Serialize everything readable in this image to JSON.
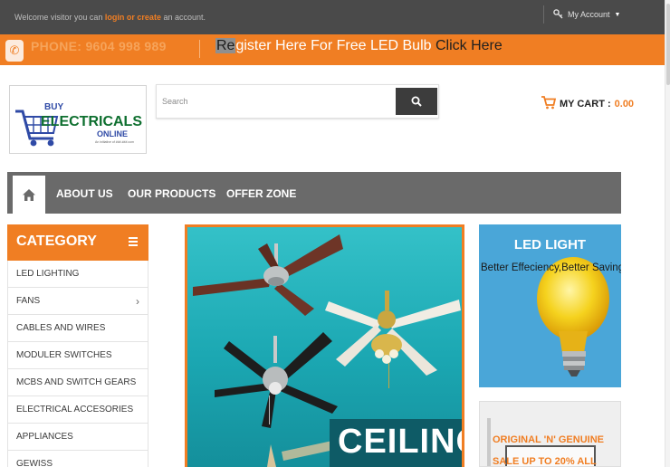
{
  "topbar": {
    "welcome_prefix": "Welcome visitor you can",
    "login_link": "login",
    "or_text": "or",
    "create_link": "create",
    "welcome_suffix": "an account.",
    "account_label": "My Account"
  },
  "banner": {
    "phone": "PHONE: 9604 998 989",
    "register_highlight": "Re",
    "register_text": "gister Here For Free LED Bulb",
    "click_here": "Click Here"
  },
  "header": {
    "search_placeholder": "Search",
    "cart_label": "MY CART :",
    "cart_amount": "0.00",
    "logo_text": {
      "buy": "BUY",
      "electricals": "ELECTRICALS",
      "online": "ONLINE",
      "tagline": "An initiative of ###.###.com"
    }
  },
  "nav": {
    "items": [
      {
        "label": "ABOUT US"
      },
      {
        "label": "OUR PRODUCTS"
      },
      {
        "label": "OFFER ZONE"
      }
    ]
  },
  "category": {
    "title": "CATEGORY",
    "items": [
      {
        "label": "LED LIGHTING"
      },
      {
        "label": "FANS"
      },
      {
        "label": "CABLES AND WIRES"
      },
      {
        "label": "MODULER SWITCHES"
      },
      {
        "label": "MCBS AND SWITCH GEARS"
      },
      {
        "label": "ELECTRICAL ACCESORIES"
      },
      {
        "label": "APPLIANCES"
      },
      {
        "label": "GEWISS"
      }
    ]
  },
  "main_banner": {
    "title": "CEILING"
  },
  "led_panel": {
    "title": "LED LIGHT",
    "subtitle": "Better Effeciency,Better Saving"
  },
  "promo": {
    "line1": "ORIGINAL 'N' GENUINE",
    "line2": "SALE UP TO 20% ALL"
  },
  "colors": {
    "accent": "#f07e23",
    "topbar": "#4a4a4a",
    "nav": "#6a6a6a",
    "led_bg": "#4aa6d8"
  }
}
